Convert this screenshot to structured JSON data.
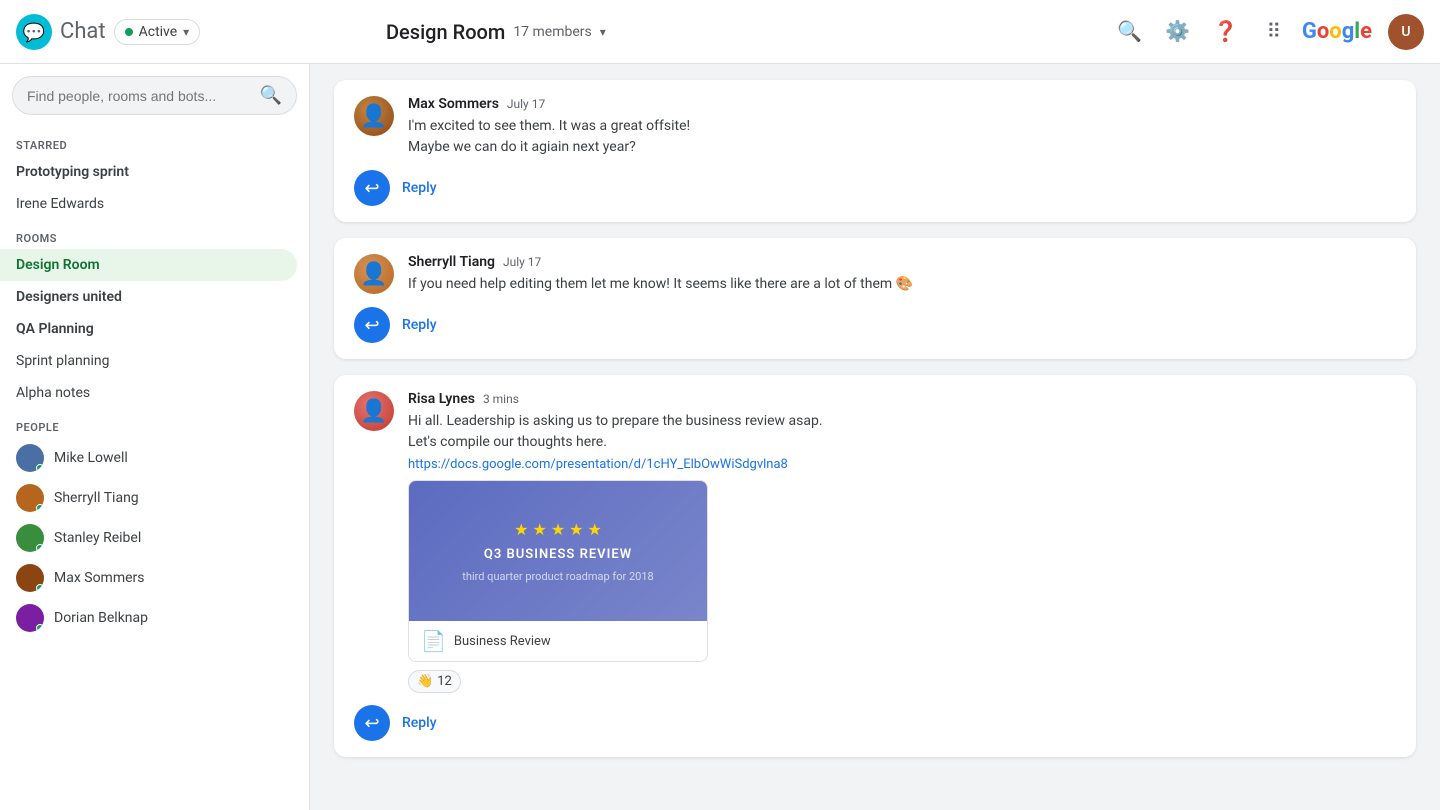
{
  "header": {
    "app_name": "Chat",
    "active_label": "Active",
    "room_name": "Design Room",
    "members_count": "17 members",
    "google_logo": "Google"
  },
  "search": {
    "placeholder": "Find people, rooms and bots..."
  },
  "sidebar": {
    "starred_label": "STARRED",
    "rooms_label": "ROOMS",
    "people_label": "PEOPLE",
    "starred_items": [
      {
        "label": "Prototyping sprint",
        "bold": true
      },
      {
        "label": "Irene Edwards",
        "bold": false
      }
    ],
    "rooms": [
      {
        "label": "Design Room",
        "active": true,
        "bold": true
      },
      {
        "label": "Designers united",
        "active": false,
        "bold": true
      },
      {
        "label": "QA Planning",
        "active": false,
        "bold": true
      },
      {
        "label": "Sprint planning",
        "active": false,
        "bold": false
      },
      {
        "label": "Alpha notes",
        "active": false,
        "bold": false
      }
    ],
    "people": [
      {
        "label": "Mike Lowell",
        "online": true
      },
      {
        "label": "Sherryll Tiang",
        "online": true
      },
      {
        "label": "Stanley Reibel",
        "online": true
      },
      {
        "label": "Max Sommers",
        "online": true
      },
      {
        "label": "Dorian Belknap",
        "online": true
      }
    ]
  },
  "messages": [
    {
      "id": "msg1",
      "sender": "Max Sommers",
      "time": "July 17",
      "lines": [
        "I'm excited to see them. It was a great offsite!",
        "Maybe we can do it agiain next year?"
      ],
      "reply_label": "Reply"
    },
    {
      "id": "msg2",
      "sender": "Sherryll Tiang",
      "time": "July 17",
      "lines": [
        "If you need help editing them let me know! It seems like there are a lot of them 🎨"
      ],
      "reply_label": "Reply"
    },
    {
      "id": "msg3",
      "sender": "Risa Lynes",
      "time": "3 mins",
      "lines": [
        "Hi all. Leadership is asking us to prepare the business review asap.",
        "Let's compile our thoughts here."
      ],
      "link_url": "https://docs.google.com/presentation/d/1cHY_ElbOwWiSdgvlna8",
      "link_card": {
        "title": "Q3 BUSINESS REVIEW",
        "subtitle": "third quarter product roadmap for 2018",
        "file_name": "Business Review"
      },
      "reaction_emoji": "👋",
      "reaction_count": "12",
      "reply_label": "Reply"
    }
  ]
}
